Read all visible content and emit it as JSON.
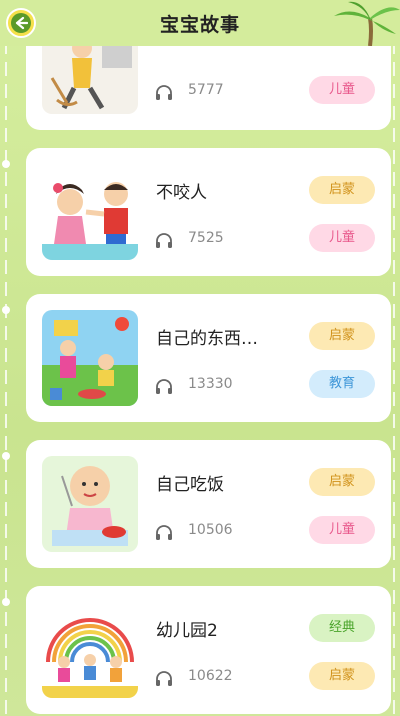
{
  "header": {
    "title": "宝宝故事",
    "back_icon": "back-arrow-icon"
  },
  "stories": [
    {
      "name": "",
      "listens": "5777",
      "tags": [
        {
          "label": "儿童",
          "color": "pink"
        }
      ]
    },
    {
      "name": "不咬人",
      "listens": "7525",
      "tags": [
        {
          "label": "启蒙",
          "color": "yellow"
        },
        {
          "label": "儿童",
          "color": "pink"
        }
      ]
    },
    {
      "name": "自己的东西…",
      "listens": "13330",
      "tags": [
        {
          "label": "启蒙",
          "color": "yellow"
        },
        {
          "label": "教育",
          "color": "blue"
        }
      ]
    },
    {
      "name": "自己吃饭",
      "listens": "10506",
      "tags": [
        {
          "label": "启蒙",
          "color": "yellow"
        },
        {
          "label": "儿童",
          "color": "pink"
        }
      ]
    },
    {
      "name": "幼儿园2",
      "listens": "10622",
      "tags": [
        {
          "label": "经典",
          "color": "green"
        },
        {
          "label": "启蒙",
          "color": "yellow"
        }
      ]
    }
  ],
  "colors": {
    "background": "#cde79a",
    "card": "#ffffff",
    "back_button": "#f5e04a"
  }
}
